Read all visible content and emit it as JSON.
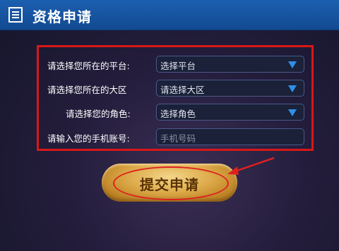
{
  "header": {
    "title": "资格申请",
    "icon": "document-list-icon"
  },
  "form": {
    "rows": [
      {
        "label": "请选择您所在的平台:",
        "value": "选择平台",
        "type": "select"
      },
      {
        "label": "请选择您所在的大区",
        "value": "请选择大区",
        "type": "select"
      },
      {
        "label": "请选择您的角色:",
        "value": "选择角色",
        "type": "select"
      },
      {
        "label": "请输入您的手机账号:",
        "placeholder": "手机号码",
        "type": "input"
      }
    ]
  },
  "submit": {
    "label": "提交申请"
  },
  "colors": {
    "header": "#1a5aa8",
    "highlight": "#d81818",
    "caret": "#2f8fe8",
    "button_gold": "#dca948"
  }
}
